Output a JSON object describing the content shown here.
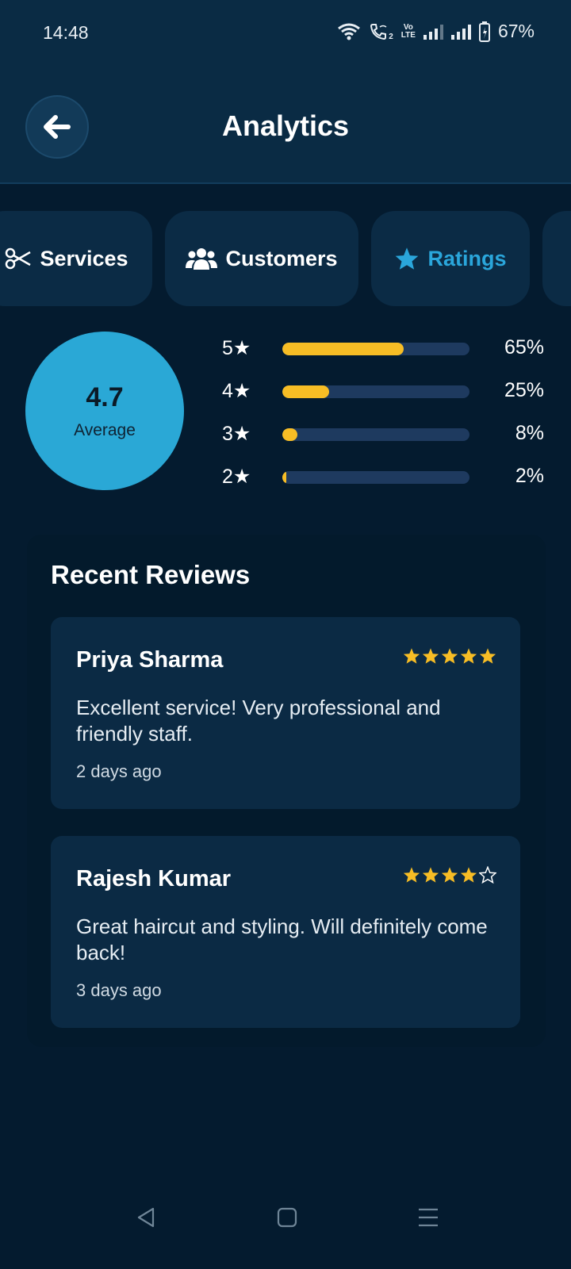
{
  "status_bar": {
    "time": "14:48",
    "volte_line1": "Vo",
    "volte_line2": "LTE",
    "sim_badge": "2",
    "battery": "67%"
  },
  "header": {
    "title": "Analytics",
    "back_icon": "arrow-left-icon"
  },
  "tabs": [
    {
      "label": "Services",
      "icon": "scissors-icon",
      "active": false
    },
    {
      "label": "Customers",
      "icon": "users-icon",
      "active": false
    },
    {
      "label": "Ratings",
      "icon": "star-icon",
      "active": true
    }
  ],
  "summary": {
    "average": "4.7",
    "average_label": "Average",
    "distribution": [
      {
        "label": "5★",
        "percent": 65,
        "percent_label": "65%"
      },
      {
        "label": "4★",
        "percent": 25,
        "percent_label": "25%"
      },
      {
        "label": "3★",
        "percent": 8,
        "percent_label": "8%"
      },
      {
        "label": "2★",
        "percent": 2,
        "percent_label": "2%"
      }
    ]
  },
  "reviews": {
    "title": "Recent Reviews",
    "items": [
      {
        "name": "Priya Sharma",
        "rating": 5,
        "text": "Excellent service! Very professional and friendly staff.",
        "time": "2 days ago"
      },
      {
        "name": "Rajesh Kumar",
        "rating": 4,
        "text": "Great haircut and styling. Will definitely come back!",
        "time": "3 days ago"
      }
    ]
  },
  "colors": {
    "accent": "#2aa6db",
    "star": "#f7bd25",
    "background": "#041b2f",
    "card": "#0b2a44"
  }
}
